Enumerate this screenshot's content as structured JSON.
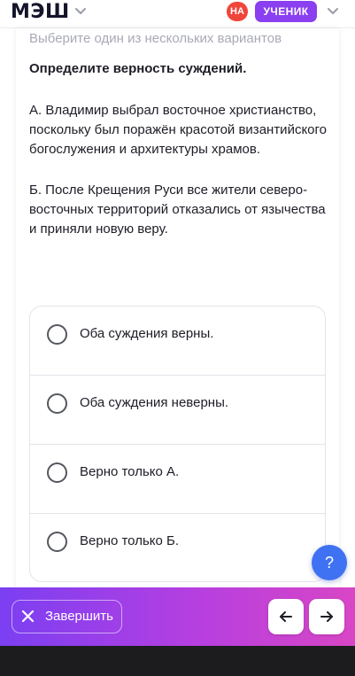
{
  "header": {
    "logo": "МЭШ",
    "na_badge": "НА",
    "role_badge": "УЧЕНИК"
  },
  "question": {
    "hint": "Выберите один из нескольких вариантов",
    "title": "Определите верность суждений.",
    "statement_a": "А. Владимир выбрал восточное христианство, поскольку был поражён красотой византийского богослужения и архитектуры храмов.",
    "statement_b": "Б. После Крещения Руси все жители северо-восточных территорий отказались от язычества и приняли новую веру."
  },
  "options": [
    {
      "label": "Оба суждения верны."
    },
    {
      "label": "Оба суждения неверны."
    },
    {
      "label": "Верно только А."
    },
    {
      "label": "Верно только Б."
    }
  ],
  "help": {
    "label": "?"
  },
  "bottom_bar": {
    "finish_label": "Завершить"
  },
  "icons": {
    "logo_dropdown": "chevron-down-icon",
    "role_dropdown": "chevron-down-icon",
    "finish": "close-icon",
    "prev": "arrow-left-icon",
    "next": "arrow-right-icon"
  },
  "colors": {
    "accent_purple": "#8a3ff0",
    "badge_red": "#f0453a",
    "help_blue": "#3f72f2",
    "bar_gradient_start": "#7b3ff2",
    "bar_gradient_end": "#d846c5"
  }
}
